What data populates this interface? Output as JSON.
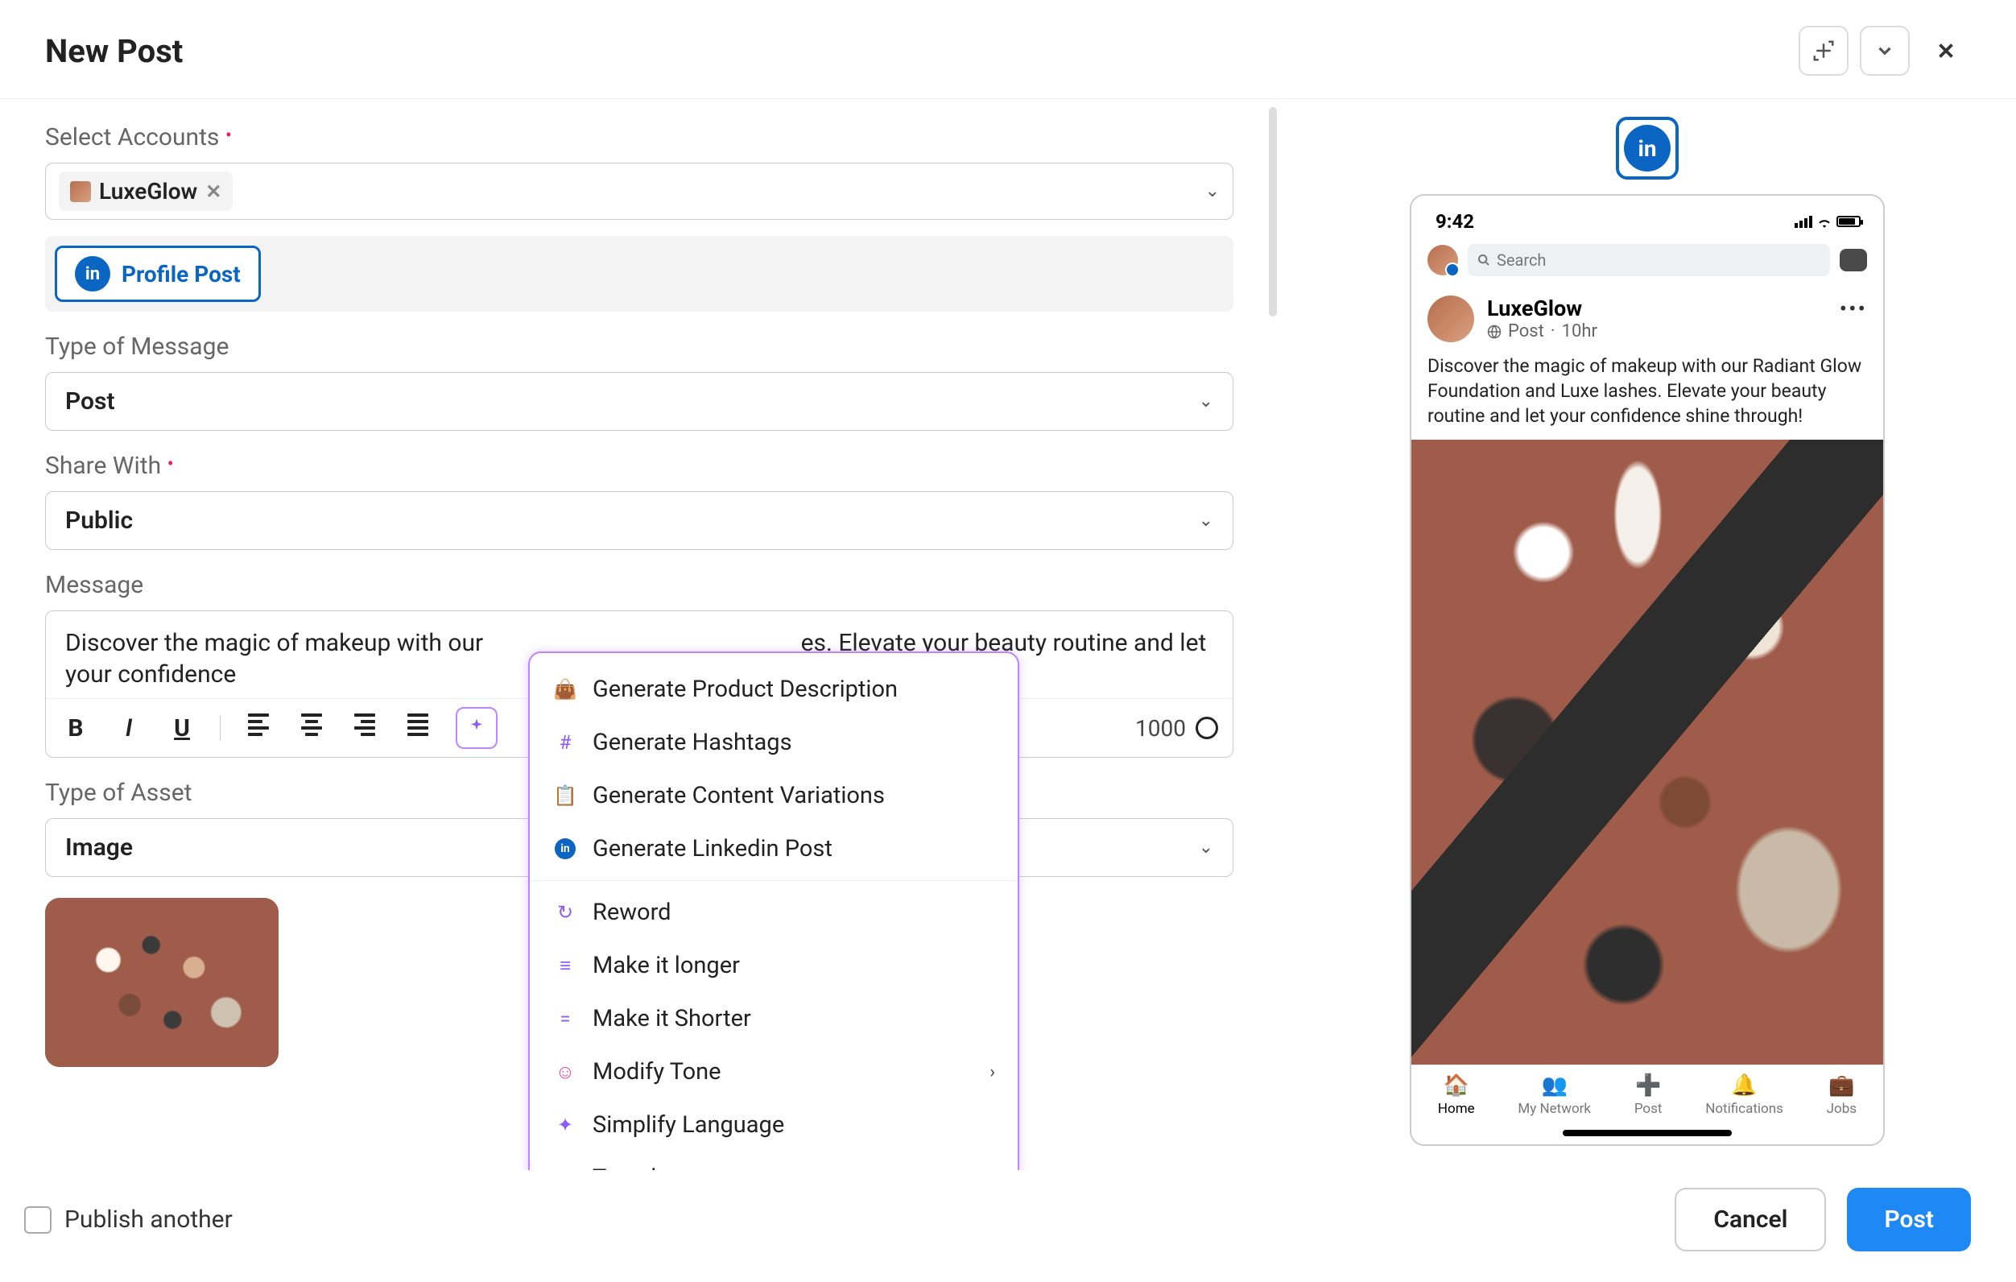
{
  "header": {
    "title": "New Post",
    "add_expand_icon": "add-expand",
    "chevron_icon": "chevron-down",
    "close_icon": "close"
  },
  "accounts": {
    "label": "Select Accounts",
    "required": true,
    "selected": [
      {
        "name": "LuxeGlow"
      }
    ]
  },
  "post_kind": {
    "button_label": "Profile Post",
    "platform": "linkedin"
  },
  "message_type": {
    "label": "Type of Message",
    "value": "Post"
  },
  "share_with": {
    "label": "Share With",
    "required": true,
    "value": "Public"
  },
  "message": {
    "label": "Message",
    "text": "Discover the magic of makeup with our Radiant Glow Foundation and Luxe lashes. Elevate your beauty routine and let your confidence shine through!",
    "visible_text": "Discover the magic of makeup with our                                                     es. Elevate your beauty routine and let your confidence",
    "char_limit": "1000"
  },
  "toolbar": {
    "bold": "B",
    "italic": "I",
    "underline": "U"
  },
  "asset": {
    "label": "Type of Asset",
    "value": "Image"
  },
  "ai_menu": {
    "items_top": [
      {
        "icon": "shopping-bag",
        "color": "ic-purple",
        "glyph": "👜",
        "label": "Generate Product Description"
      },
      {
        "icon": "hashtag",
        "color": "ic-purple",
        "glyph": "#",
        "label": "Generate Hashtags"
      },
      {
        "icon": "clipboard",
        "color": "ic-purple",
        "glyph": "📋",
        "label": "Generate Content Variations"
      },
      {
        "icon": "linkedin",
        "color": "ic-blue",
        "glyph": "in",
        "label": "Generate Linkedin Post"
      }
    ],
    "items_bottom": [
      {
        "icon": "reword",
        "color": "ic-purple",
        "glyph": "↻",
        "label": "Reword",
        "chevron": false
      },
      {
        "icon": "longer",
        "color": "ic-purple",
        "glyph": "≡",
        "label": "Make it longer",
        "chevron": false
      },
      {
        "icon": "shorter",
        "color": "ic-purple",
        "glyph": "=",
        "label": "Make it Shorter",
        "chevron": false
      },
      {
        "icon": "tone",
        "color": "ic-pink",
        "glyph": "☺",
        "label": "Modify Tone",
        "chevron": true
      },
      {
        "icon": "simplify",
        "color": "ic-purple",
        "glyph": "✦",
        "label": "Simplify Language",
        "chevron": false
      },
      {
        "icon": "translate",
        "color": "ic-purple",
        "glyph": "Aᵗ",
        "label": "Translate",
        "chevron": true
      }
    ]
  },
  "preview": {
    "time": "9:42",
    "search_placeholder": "Search",
    "profile_name": "LuxeGlow",
    "meta_kind": "Post",
    "meta_time": "10hr",
    "body": "Discover the magic of makeup with our Radiant Glow Foundation and Luxe lashes. Elevate your beauty routine and let your confidence shine through!",
    "tabs": [
      {
        "icon": "🏠",
        "label": "Home",
        "active": true
      },
      {
        "icon": "👥",
        "label": "My Network",
        "active": false
      },
      {
        "icon": "➕",
        "label": "Post",
        "active": false
      },
      {
        "icon": "🔔",
        "label": "Notifications",
        "active": false
      },
      {
        "icon": "💼",
        "label": "Jobs",
        "active": false
      }
    ]
  },
  "footer": {
    "publish_another": "Publish another",
    "cancel": "Cancel",
    "post": "Post"
  }
}
